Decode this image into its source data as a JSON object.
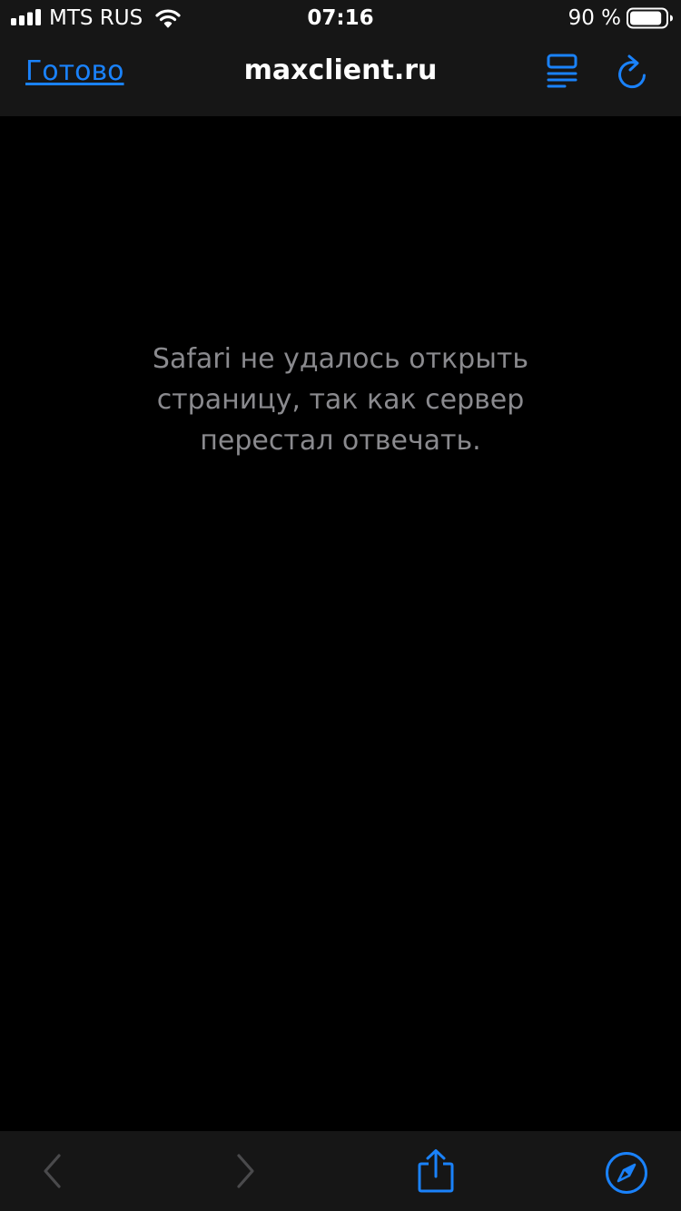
{
  "status_bar": {
    "carrier": "MTS RUS",
    "time": "07:16",
    "battery_percent": "90 %",
    "battery_level": 0.9,
    "signal_bars": 4,
    "icons": [
      "signal-icon",
      "wifi-icon",
      "battery-icon"
    ]
  },
  "nav_bar": {
    "done_label": "Готово",
    "host": "maxclient.ru",
    "icons": [
      "reader-icon",
      "reload-icon"
    ]
  },
  "content": {
    "error_lines": [
      "Safari не удалось открыть",
      "страницу, так как сервер",
      "перестал отвечать."
    ]
  },
  "toolbar": {
    "icons": [
      "chevron-left-icon",
      "chevron-right-icon",
      "share-icon",
      "compass-icon"
    ],
    "back_enabled": false,
    "forward_enabled": false
  },
  "colors": {
    "accent": "#1a82fb",
    "bar_background": "#161616",
    "page_background": "#000000",
    "message_text": "#8a8a8e",
    "disabled_icon": "#4a4a4c"
  }
}
